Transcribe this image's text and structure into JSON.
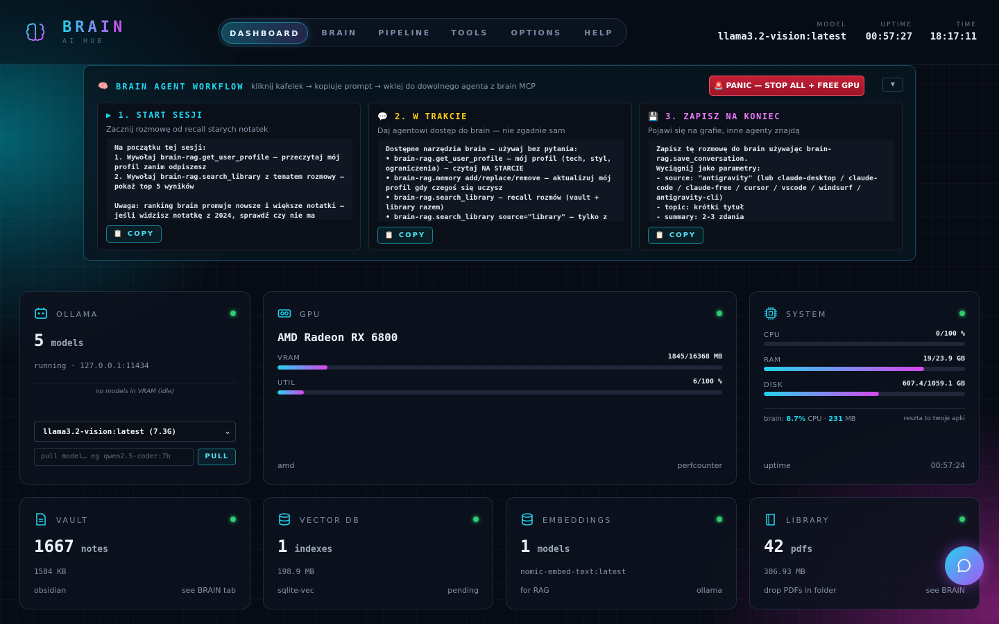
{
  "header": {
    "logo_title": "BRAIN",
    "logo_sub": "AI HUB",
    "tabs": [
      "DASHBOARD",
      "BRAIN",
      "PIPELINE",
      "TOOLS",
      "OPTIONS",
      "HELP"
    ],
    "model_label": "MODEL",
    "model_value": "llama3.2-vision:latest",
    "uptime_label": "UPTIME",
    "uptime_value": "00:57:27",
    "time_label": "TIME",
    "time_value": "18:17:11"
  },
  "workflow": {
    "icon": "brain-icon",
    "title": "BRAIN AGENT WORKFLOW",
    "subtitle": "kliknij kafelek → kopiuje prompt → wklej do dowolnego agenta z brain MCP",
    "panic_label": "🚨 PANIC — STOP ALL + FREE GPU",
    "toggle_label": "▼",
    "cards": [
      {
        "title": "▶ 1. START SESJI",
        "desc": "Zacznij rozmowę od recall starych notatek",
        "prompt": "Na początku tej sesji:\n1. Wywołaj brain-rag.get_user_profile — przeczytaj mój profil zanim odpiszesz\n2. Wywołaj brain-rag.search_library z tematem rozmowy — pokaż top 5 wyników\n\nUwaga: ranking brain promuje nowsze i większe notatki — jeśli widzisz notatkę z 2024, sprawdź czy nie ma",
        "copy": "COPY"
      },
      {
        "title": "💬 2. W TRAKCIE",
        "desc": "Daj agentowi dostęp do brain — nie zgadnie sam",
        "prompt": "Dostępne narzędzia brain — używaj bez pytania:\n• brain-rag.get_user_profile — mój profil (tech, styl, ograniczenia) — czytaj NA STARCIE\n• brain-rag.memory add/replace/remove — aktualizuj mój profil gdy czegoś się uczysz\n• brain-rag.search_library — recall rozmów (vault + library razem)\n• brain-rag.search_library source=\"library\" — tylko z",
        "copy": "COPY"
      },
      {
        "title": "💾 3. ZAPISZ NA KONIEC",
        "desc": "Pojawi się na grafie, inne agenty znajdą",
        "prompt": "Zapisz tę rozmowę do brain używając brain-rag.save_conversation.\nWyciągnij jako parametry:\n- source: \"antigravity\" (lub claude-desktop / claude-code / claude-free / cursor / vscode / windsurf / antigravity-cli)\n- topic: krótki tytuł\n- summary: 2-3 zdania",
        "copy": "COPY"
      }
    ]
  },
  "ollama": {
    "label": "OLLAMA",
    "count": "5",
    "unit": "models",
    "status": "running · 127.0.0.1:11434",
    "vram_note": "no models in VRAM (idle)",
    "selected_model": "llama3.2-vision:latest (7.3G)",
    "pull_placeholder": "pull model… eg qwen2.5-coder:7b",
    "pull_label": "PULL"
  },
  "gpu": {
    "label": "GPU",
    "name": "AMD Radeon RX 6800",
    "vram_label": "VRAM",
    "vram_value": "1845/16368 MB",
    "vram_fraction": 0.113,
    "util_label": "UTIL",
    "util_value": "6/100 %",
    "util_fraction": 0.06,
    "foot_left": "amd",
    "foot_right": "perfcounter"
  },
  "system": {
    "label": "SYSTEM",
    "cpu_label": "CPU",
    "cpu_value": "0/100 %",
    "cpu_fraction": 0.0,
    "ram_label": "RAM",
    "ram_value": "19/23.9 GB",
    "ram_fraction": 0.795,
    "disk_label": "DISK",
    "disk_value": "607.4/1059.1 GB",
    "disk_fraction": 0.573,
    "brain_prefix": "brain:",
    "brain_cpu": "8.7%",
    "brain_cpu_unit": "CPU ·",
    "brain_mem": "231",
    "brain_mem_unit": "MB",
    "rest_note": "reszta to twoje apki",
    "uptime_label": "uptime",
    "uptime_value": "00:57:24"
  },
  "vault": {
    "label": "VAULT",
    "count": "1667",
    "unit": "notes",
    "sub": "1584 KB",
    "foot_left": "obsidian",
    "foot_right": "see BRAIN tab"
  },
  "vectordb": {
    "label": "VECTOR DB",
    "count": "1",
    "unit": "indexes",
    "sub": "198.9 MB",
    "foot_left": "sqlite-vec",
    "foot_right": "pending"
  },
  "embeddings": {
    "label": "EMBEDDINGS",
    "count": "1",
    "unit": "models",
    "sub": "nomic-embed-text:latest",
    "foot_left": "for RAG",
    "foot_right": "ollama"
  },
  "library": {
    "label": "LIBRARY",
    "count": "42",
    "unit": "pdfs",
    "sub": "306.93 MB",
    "foot_left": "drop PDFs in folder",
    "foot_right": "see BRAIN"
  },
  "colors": {
    "accent_cyan": "#22d3ee",
    "accent_magenta": "#d946ef",
    "status_ok": "#2ecc71",
    "panic_red": "#c42036"
  }
}
